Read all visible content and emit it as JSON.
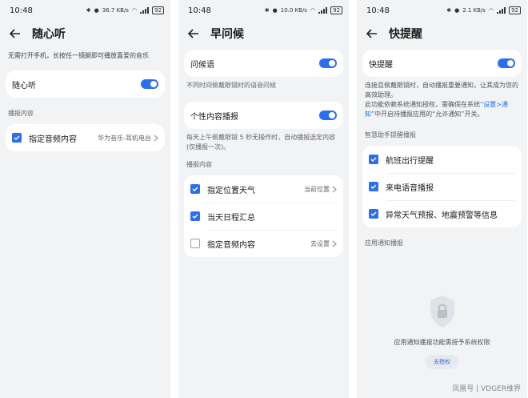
{
  "status": {
    "time": "10:48",
    "battery": "92",
    "speeds": [
      "36.7 KB/s",
      "10.0 KB/s",
      "2.1 KB/s"
    ]
  },
  "screen1": {
    "title": "随心听",
    "hint": "无需打开手机，长按任一镜腿即可播放喜爱的音乐",
    "toggle_label": "随心听",
    "toggle_on": true,
    "section": "播报内容",
    "rows": [
      {
        "label": "指定音频内容",
        "value": "华为音乐-耳机电台",
        "checked": true
      }
    ]
  },
  "screen2": {
    "title": "早问候",
    "greeting_label": "问候语",
    "greeting_on": true,
    "greeting_hint": "不同时间佩戴眼镜时的语音问候",
    "personal_label": "个性内容播报",
    "personal_on": true,
    "personal_hint": "每天上午佩戴眼镜 5 秒无操作时，自动播报选定内容(仅播报一次)。",
    "section": "播报内容",
    "rows": [
      {
        "label": "指定位置天气",
        "value": "当前位置",
        "checked": true
      },
      {
        "label": "当天日程汇总",
        "value": "",
        "checked": true
      },
      {
        "label": "指定音频内容",
        "value": "去设置",
        "checked": false
      }
    ]
  },
  "screen3": {
    "title": "快提醒",
    "toggle_label": "快提醒",
    "toggle_on": true,
    "hint_part1": "连接且佩戴眼镜时，自动播报重要通知，让其成为您的高效助理。",
    "hint_part2": "此功能依赖系统通知授权，需确保在系统",
    "hint_link": "“设置>通知”",
    "hint_part3": "中开启待播报应用的“允许通知”开关。",
    "section1": "智慧助手提醒播报",
    "rows": [
      {
        "label": "航班出行提醒",
        "checked": true
      },
      {
        "label": "来电语音播报",
        "checked": true
      },
      {
        "label": "异常天气预报、地震预警等信息",
        "checked": true
      }
    ],
    "section2": "应用通知播报",
    "empty_text": "应用通知播报功能需授予系统权限",
    "auth_button": "去授权"
  },
  "watermark": "凤凰号 | VDGER维界",
  "colors": {
    "accent": "#2b6ef2",
    "background": "#f1f3f5",
    "card": "#ffffff"
  }
}
